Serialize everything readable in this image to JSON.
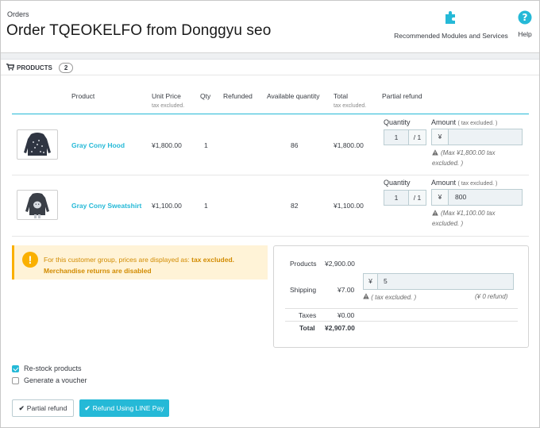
{
  "header": {
    "breadcrumb": "Orders",
    "title": "Order TQEOKELFO from Donggyu seo",
    "modules_label": "Recommended Modules and Services",
    "help_label": "Help"
  },
  "products_panel": {
    "title": "PRODUCTS",
    "count": "2",
    "columns": {
      "product": "Product",
      "unit_price": "Unit Price",
      "unit_price_sub": "tax excluded.",
      "qty": "Qty",
      "refunded": "Refunded",
      "available": "Available quantity",
      "total": "Total",
      "total_sub": "tax excluded.",
      "partial_refund": "Partial refund"
    },
    "rows": [
      {
        "name": "Gray Cony Hood",
        "unit_price": "¥1,800.00",
        "qty": "1",
        "available": "86",
        "total": "¥1,800.00",
        "quantity_label": "Quantity",
        "quantity_value": "1",
        "quantity_max": "/ 1",
        "amount_label": "Amount",
        "amount_note": "( tax excluded. )",
        "currency": "¥",
        "amount_value": "",
        "max_note": "(Max ¥1,800.00 tax excluded. )"
      },
      {
        "name": "Gray Cony Sweatshirt",
        "unit_price": "¥1,100.00",
        "qty": "1",
        "available": "82",
        "total": "¥1,100.00",
        "quantity_label": "Quantity",
        "quantity_value": "1",
        "quantity_max": "/ 1",
        "amount_label": "Amount",
        "amount_note": "( tax excluded. )",
        "currency": "¥",
        "amount_value": "800",
        "max_note": "(Max ¥1,100.00 tax excluded. )"
      }
    ]
  },
  "alert": {
    "prefix": "For this customer group, prices are displayed as: ",
    "emphasis": "tax excluded.",
    "line2": "Merchandise returns are disabled"
  },
  "summary": {
    "products_label": "Products",
    "products_value": "¥2,900.00",
    "shipping_label": "Shipping",
    "shipping_value": "¥7.00",
    "shipping_currency": "¥",
    "shipping_input": "5",
    "shipping_note": "( tax excluded. )",
    "shipping_refund": "(¥ 0 refund)",
    "taxes_label": "Taxes",
    "taxes_value": "¥0.00",
    "total_label": "Total",
    "total_value": "¥2,907.00"
  },
  "options": {
    "restock_label": "Re-stock products",
    "restock_checked": true,
    "voucher_label": "Generate a voucher",
    "voucher_checked": false
  },
  "actions": {
    "partial_refund": "Partial refund",
    "refund_line_pay": "Refund Using LINE Pay"
  },
  "colors": {
    "accent": "#25b9d7",
    "warning": "#fab000",
    "warning_bg": "#fff3d7"
  }
}
